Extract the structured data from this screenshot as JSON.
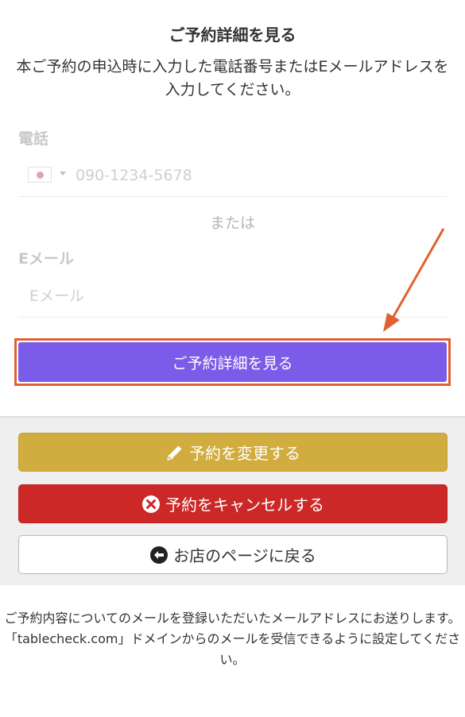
{
  "title": "ご予約詳細を見る",
  "description": "本ご予約の申込時に入力した電話番号またはEメールアドレスを入力してください。",
  "phone": {
    "label": "電話",
    "placeholder": "090-1234-5678",
    "country_icon": "japan-flag-icon"
  },
  "or_text": "または",
  "email": {
    "label": "Eメール",
    "placeholder": "Eメール"
  },
  "submit_label": "ご予約詳細を見る",
  "actions": {
    "change_label": "予約を変更する",
    "cancel_label": "予約をキャンセルする",
    "back_label": "お店のページに戻る"
  },
  "notice": {
    "line1": "ご予約内容についてのメールを登録いただいたメールアドレスにお送りします。",
    "line2": "「tablecheck.com」ドメインからのメールを受信できるように設定してください。"
  },
  "colors": {
    "submit": "#7b5ce9",
    "change": "#d1ac3f",
    "cancel": "#cd2828",
    "annotation": "#e0602f"
  }
}
